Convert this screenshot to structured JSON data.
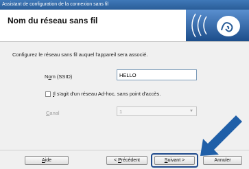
{
  "window": {
    "title": "Assistant de configuration de la connexion sans fil"
  },
  "header": {
    "title": "Nom du réseau sans fil"
  },
  "body": {
    "description": "Configurez le réseau sans fil auquel l'appareil sera associé.",
    "ssid_label_prefix": "N",
    "ssid_label_accel": "o",
    "ssid_label_rest": "m (SSID)",
    "ssid_value": "HELLO",
    "adhoc_checked": false,
    "adhoc_label_accel": "I",
    "adhoc_label_rest": "l s'agit d'un réseau Ad-hoc, sans point d'accès.",
    "channel_label_accel": "C",
    "channel_label_rest": "anal",
    "channel_value": "1"
  },
  "footer": {
    "help_accel": "A",
    "help_rest": "ide",
    "prev_prefix": "< ",
    "prev_accel": "P",
    "prev_rest": "récédent",
    "next_accel": "S",
    "next_rest": "uivant >",
    "cancel_label": "Annuler"
  },
  "colors": {
    "accent": "#2a5d98",
    "arrow": "#1f5fa8"
  }
}
